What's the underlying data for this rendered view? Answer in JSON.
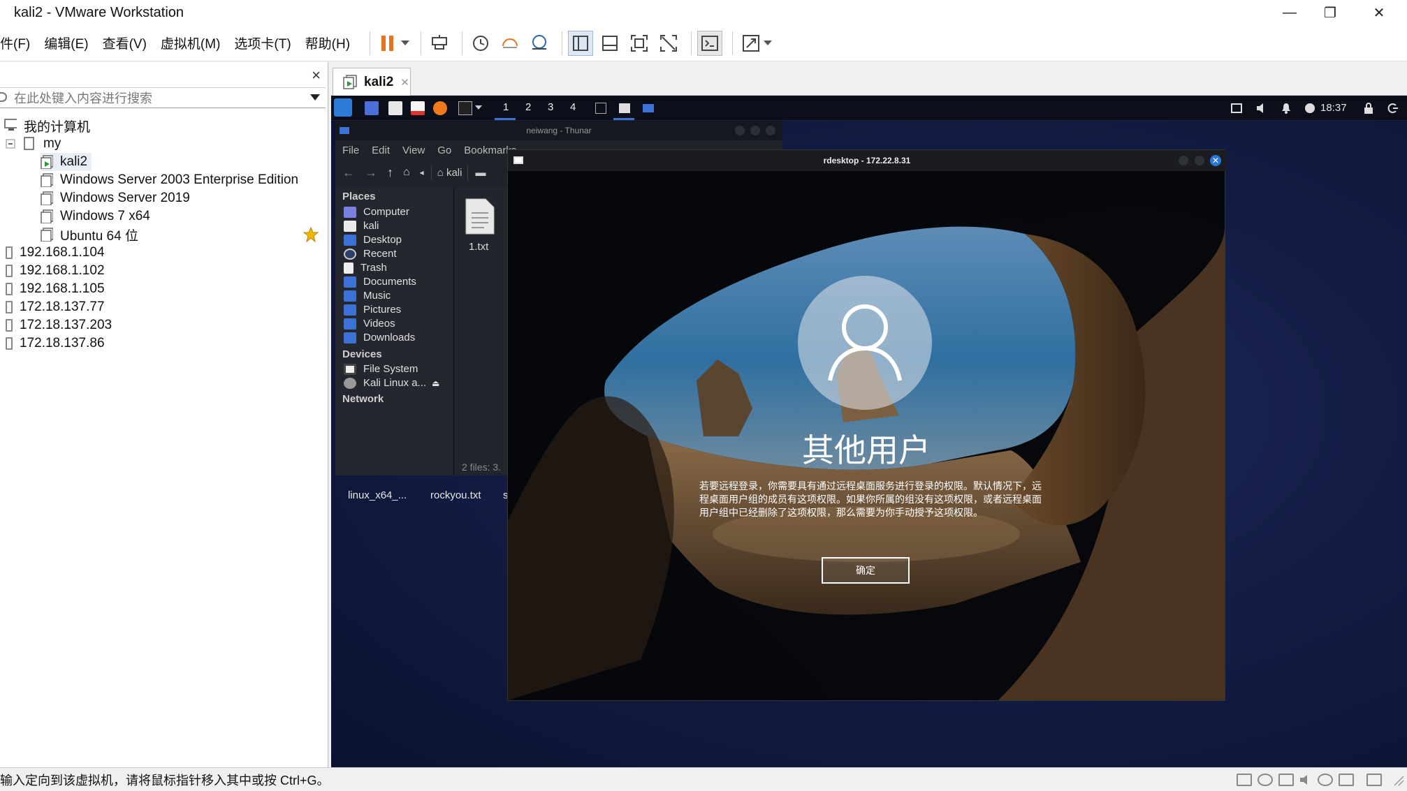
{
  "window": {
    "title": "kali2 - VMware Workstation",
    "minimize": "—",
    "maximize": "❐",
    "close": "✕"
  },
  "menubar": {
    "items": [
      "件(F)",
      "编辑(E)",
      "查看(V)",
      "虚拟机(M)",
      "选项卡(T)",
      "帮助(H)"
    ]
  },
  "library": {
    "close": "×",
    "search_placeholder": "在此处键入内容进行搜索",
    "root": "我的计算机",
    "folder": "my",
    "vms": [
      "kali2",
      "Windows Server 2003 Enterprise Edition",
      "Windows Server 2019",
      "Windows 7 x64",
      "Ubuntu 64 位"
    ],
    "hosts": [
      "192.168.1.104",
      "192.168.1.102",
      "192.168.1.105",
      "172.18.137.77",
      "172.18.137.203",
      "172.18.137.86"
    ]
  },
  "tab": {
    "label": "kali2",
    "close": "✕"
  },
  "kali_panel": {
    "workspaces": [
      "1",
      "2",
      "3",
      "4"
    ],
    "clock": "18:37"
  },
  "thunar": {
    "title": "neiwang - Thunar",
    "menu": [
      "File",
      "Edit",
      "View",
      "Go",
      "Bookmarks"
    ],
    "path": "kali",
    "places_header": "Places",
    "places": [
      "Computer",
      "kali",
      "Desktop",
      "Recent",
      "Trash",
      "Documents",
      "Music",
      "Pictures",
      "Videos",
      "Downloads"
    ],
    "devices_header": "Devices",
    "devices": [
      "File System",
      "Kali Linux a..."
    ],
    "network_header": "Network",
    "file": "1.txt",
    "status": "2 files: 3."
  },
  "desktop": {
    "icons": [
      "linux_x64_...",
      "rockyou.txt",
      "s"
    ]
  },
  "rdesktop": {
    "title": "rdesktop - 172.22.8.31",
    "username": "其他用户",
    "message": "若要远程登录，你需要具有通过远程桌面服务进行登录的权限。默认情况下，远程桌面用户组的成员有这项权限。如果你所属的组没有这项权限，或者远程桌面用户组中已经删除了这项权限，那么需要为你手动授予这项权限。",
    "ok": "确定"
  },
  "statusbar": {
    "message": "输入定向到该虚拟机，请将鼠标指针移入其中或按 Ctrl+G。"
  },
  "colors": {
    "pause_orange": "#e8731c",
    "kali_blue": "#3c71d8",
    "star": "#f2b705"
  }
}
